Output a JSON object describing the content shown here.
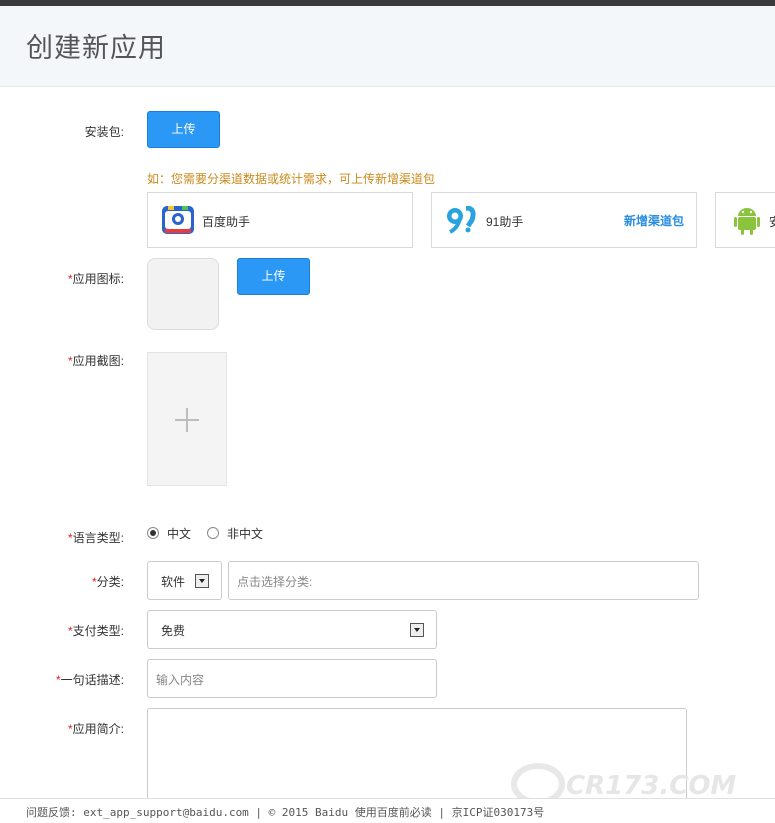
{
  "page": {
    "title": "创建新应用"
  },
  "package": {
    "label": "安装包:",
    "upload_label": "上传",
    "hint": "如：您需要分渠道数据或统计需求，可上传新增渠道包",
    "channels": [
      {
        "name": "百度助手",
        "icon": "baidu-assistant-icon"
      },
      {
        "name": "91助手",
        "icon": "91-assistant-icon",
        "action": "新增渠道包"
      },
      {
        "name": "安",
        "icon": "android-icon"
      }
    ]
  },
  "app_icon": {
    "required_mark": "*",
    "label": "应用图标:",
    "upload_label": "上传"
  },
  "screenshot": {
    "required_mark": "*",
    "label": "应用截图:",
    "add_icon": "plus-icon"
  },
  "language": {
    "required_mark": "*",
    "label": "语言类型:",
    "options": [
      {
        "label": "中文",
        "selected": true
      },
      {
        "label": "非中文",
        "selected": false
      }
    ]
  },
  "category": {
    "required_mark": "*",
    "label": "分类:",
    "type_value": "软件",
    "placeholder": "点击选择分类:"
  },
  "payment": {
    "required_mark": "*",
    "label": "支付类型:",
    "value": "免费"
  },
  "one_line": {
    "required_mark": "*",
    "label": "一句话描述:",
    "placeholder": "输入内容"
  },
  "intro": {
    "required_mark": "*",
    "label": "应用简介:"
  },
  "footer": {
    "text": "问题反馈: ext_app_support@baidu.com | © 2015 Baidu 使用百度前必读 | 京ICP证030173号"
  },
  "colors": {
    "primary": "#2b98f6",
    "required": "#e02020",
    "hint": "#c98a1b",
    "link": "#2b8ee0"
  },
  "watermark": {
    "text": "CR173.COM"
  }
}
